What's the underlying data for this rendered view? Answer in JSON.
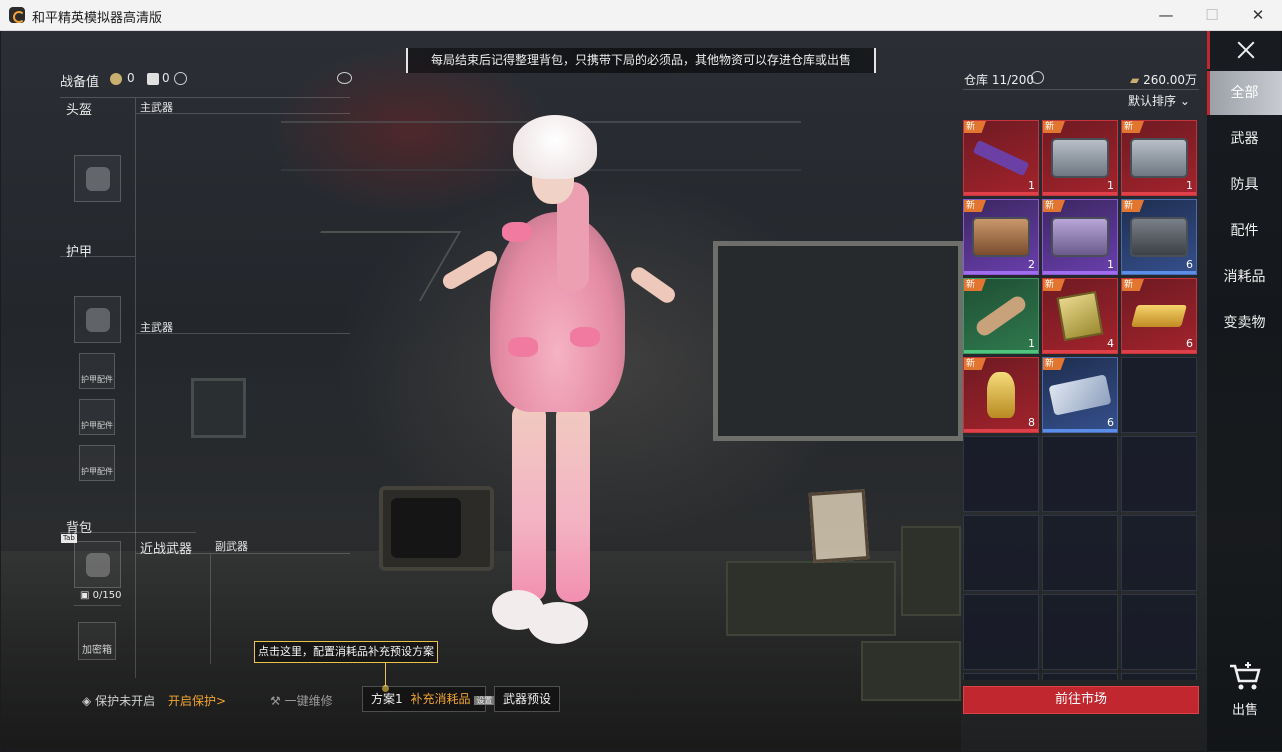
{
  "window": {
    "title": "和平精英模拟器高清版",
    "minimize": "—",
    "maximize": "☐",
    "close": "✕"
  },
  "notice": "每局结束后记得整理背包，只携带下局的必须品，其他物资可以存进仓库或出售",
  "loadout": {
    "readiness_label": "战备值",
    "readiness_value": "0",
    "locked_value": "0",
    "helmet": "头盔",
    "primary_weapon_1": "主武器",
    "armor": "护甲",
    "primary_weapon_2": "主武器",
    "armor_attachments": [
      "护甲配件",
      "护甲配件",
      "护甲配件"
    ],
    "backpack": "背包",
    "backpack_tab_tag": "Tab",
    "backpack_capacity": "0/150",
    "melee": "近战武器",
    "secondary": "副武器",
    "safe_box": "加密箱"
  },
  "tooltip": "点击这里，配置消耗品补充预设方案",
  "bottom_bar": {
    "protection_status": "保护未开启",
    "enable_protection": "开启保护>",
    "repair_all": "一键维修",
    "plan": "方案1",
    "refill_consumables": "补充消耗品",
    "refill_tag": "设置",
    "weapon_presets": "武器预设"
  },
  "warehouse": {
    "label": "仓库",
    "capacity": "11/200",
    "currency": "260.00万",
    "sort": "默认排序",
    "new_tag": "新",
    "items": [
      {
        "name": "rifle-item",
        "rarity": "red",
        "count": "1",
        "icon": "ic-rifle"
      },
      {
        "name": "steel-case-item",
        "rarity": "red",
        "count": "1",
        "icon": "ic-case"
      },
      {
        "name": "steel-case-item",
        "rarity": "red",
        "count": "1",
        "icon": "ic-case"
      },
      {
        "name": "copper-case-item",
        "rarity": "purple",
        "count": "2",
        "icon": "ic-case copper"
      },
      {
        "name": "lilac-case-item",
        "rarity": "purple",
        "count": "1",
        "icon": "ic-case lilac"
      },
      {
        "name": "dark-case-item",
        "rarity": "blue",
        "count": "6",
        "icon": "ic-case dark"
      },
      {
        "name": "scroll-item",
        "rarity": "green",
        "count": "1",
        "icon": "ic-scroll"
      },
      {
        "name": "document-item",
        "rarity": "red",
        "count": "4",
        "icon": "ic-book"
      },
      {
        "name": "gold-bar-item",
        "rarity": "red",
        "count": "6",
        "icon": "ic-gold"
      },
      {
        "name": "trophy-item",
        "rarity": "red",
        "count": "8",
        "icon": "ic-trophy"
      },
      {
        "name": "ticket-item",
        "rarity": "blue",
        "count": "6",
        "icon": "ic-ticket"
      }
    ],
    "market_button": "前往市场"
  },
  "tabs": [
    "全部",
    "武器",
    "防具",
    "配件",
    "消耗品",
    "变卖物"
  ],
  "sell_label": "出售",
  "colors": {
    "accent_red": "#c1272e",
    "rarity_red": "#a3232c",
    "rarity_purple": "#6a3fae",
    "rarity_blue": "#35508d",
    "rarity_green": "#2f7a4e",
    "tooltip_gold": "#e9c34a"
  }
}
